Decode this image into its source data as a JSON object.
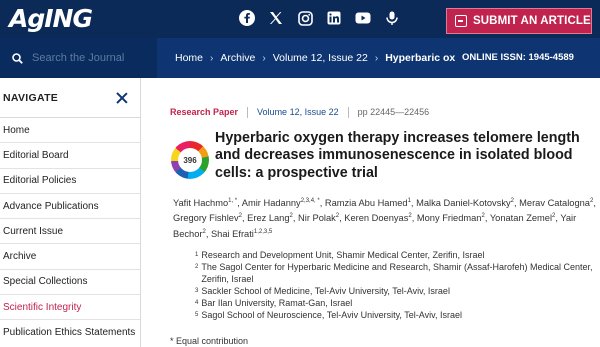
{
  "header": {
    "logo_text": "AgING",
    "social_icons": [
      "facebook-icon",
      "x-twitter-icon",
      "instagram-icon",
      "linkedin-icon",
      "youtube-icon",
      "podcast-icon"
    ],
    "submit_label": "SUBMIT AN ARTICLE",
    "brand_color": "#0b2a58",
    "accent_color": "#c0234d"
  },
  "search": {
    "placeholder": "Search the Journal"
  },
  "breadcrumb": {
    "items": [
      "Home",
      "Archive",
      "Volume 12, Issue 22"
    ],
    "current": "Hyperbaric ox",
    "issn": "ONLINE ISSN: 1945-4589"
  },
  "sidebar": {
    "title": "NAVIGATE",
    "items": [
      "Home",
      "Editorial Board",
      "Editorial Policies",
      "Advance Publications",
      "Current Issue",
      "Archive",
      "Special Collections",
      "Scientific Integrity",
      "Publication Ethics Statements"
    ],
    "active_item": "Scientific Integrity"
  },
  "article": {
    "type": "Research Paper",
    "volume": "Volume 12, Issue 22",
    "pages": "pp 22445—22456",
    "altmetric_score": "396",
    "title": "Hyperbaric oxygen therapy increases telomere length and decreases immunosenescence in isolated blood cells: a prospective trial",
    "authors": [
      {
        "name": "Yafit Hachmo",
        "sup": "1, *"
      },
      {
        "name": "Amir Hadanny",
        "sup": "2,3,4, *"
      },
      {
        "name": "Ramzia Abu Hamed",
        "sup": "1"
      },
      {
        "name": "Malka Daniel-Kotovsky",
        "sup": "2"
      },
      {
        "name": "Merav Catalogna",
        "sup": "2"
      },
      {
        "name": "Gregory Fishlev",
        "sup": "2"
      },
      {
        "name": "Erez Lang",
        "sup": "2"
      },
      {
        "name": "Nir Polak",
        "sup": "2"
      },
      {
        "name": "Keren Doenyas",
        "sup": "2"
      },
      {
        "name": "Mony Friedman",
        "sup": "2"
      },
      {
        "name": "Yonatan Zemel",
        "sup": "2"
      },
      {
        "name": "Yair Bechor",
        "sup": "2"
      },
      {
        "name": "Shai Efrati",
        "sup": "1,2,3,5"
      }
    ],
    "affiliations": [
      {
        "num": "1",
        "text": "Research and Development Unit, Shamir Medical Center, Zerifin, Israel"
      },
      {
        "num": "2",
        "text": "The Sagol Center for Hyperbaric Medicine and Research, Shamir (Assaf-Harofeh) Medical Center, Zerifin, Israel"
      },
      {
        "num": "3",
        "text": "Sackler School of Medicine, Tel-Aviv University, Tel-Aviv, Israel"
      },
      {
        "num": "4",
        "text": "Bar Ilan University, Ramat-Gan, Israel"
      },
      {
        "num": "5",
        "text": "Sagol School of Neuroscience, Tel-Aviv University, Tel-Aviv, Israel"
      }
    ],
    "equal_contribution": "* Equal contribution"
  }
}
